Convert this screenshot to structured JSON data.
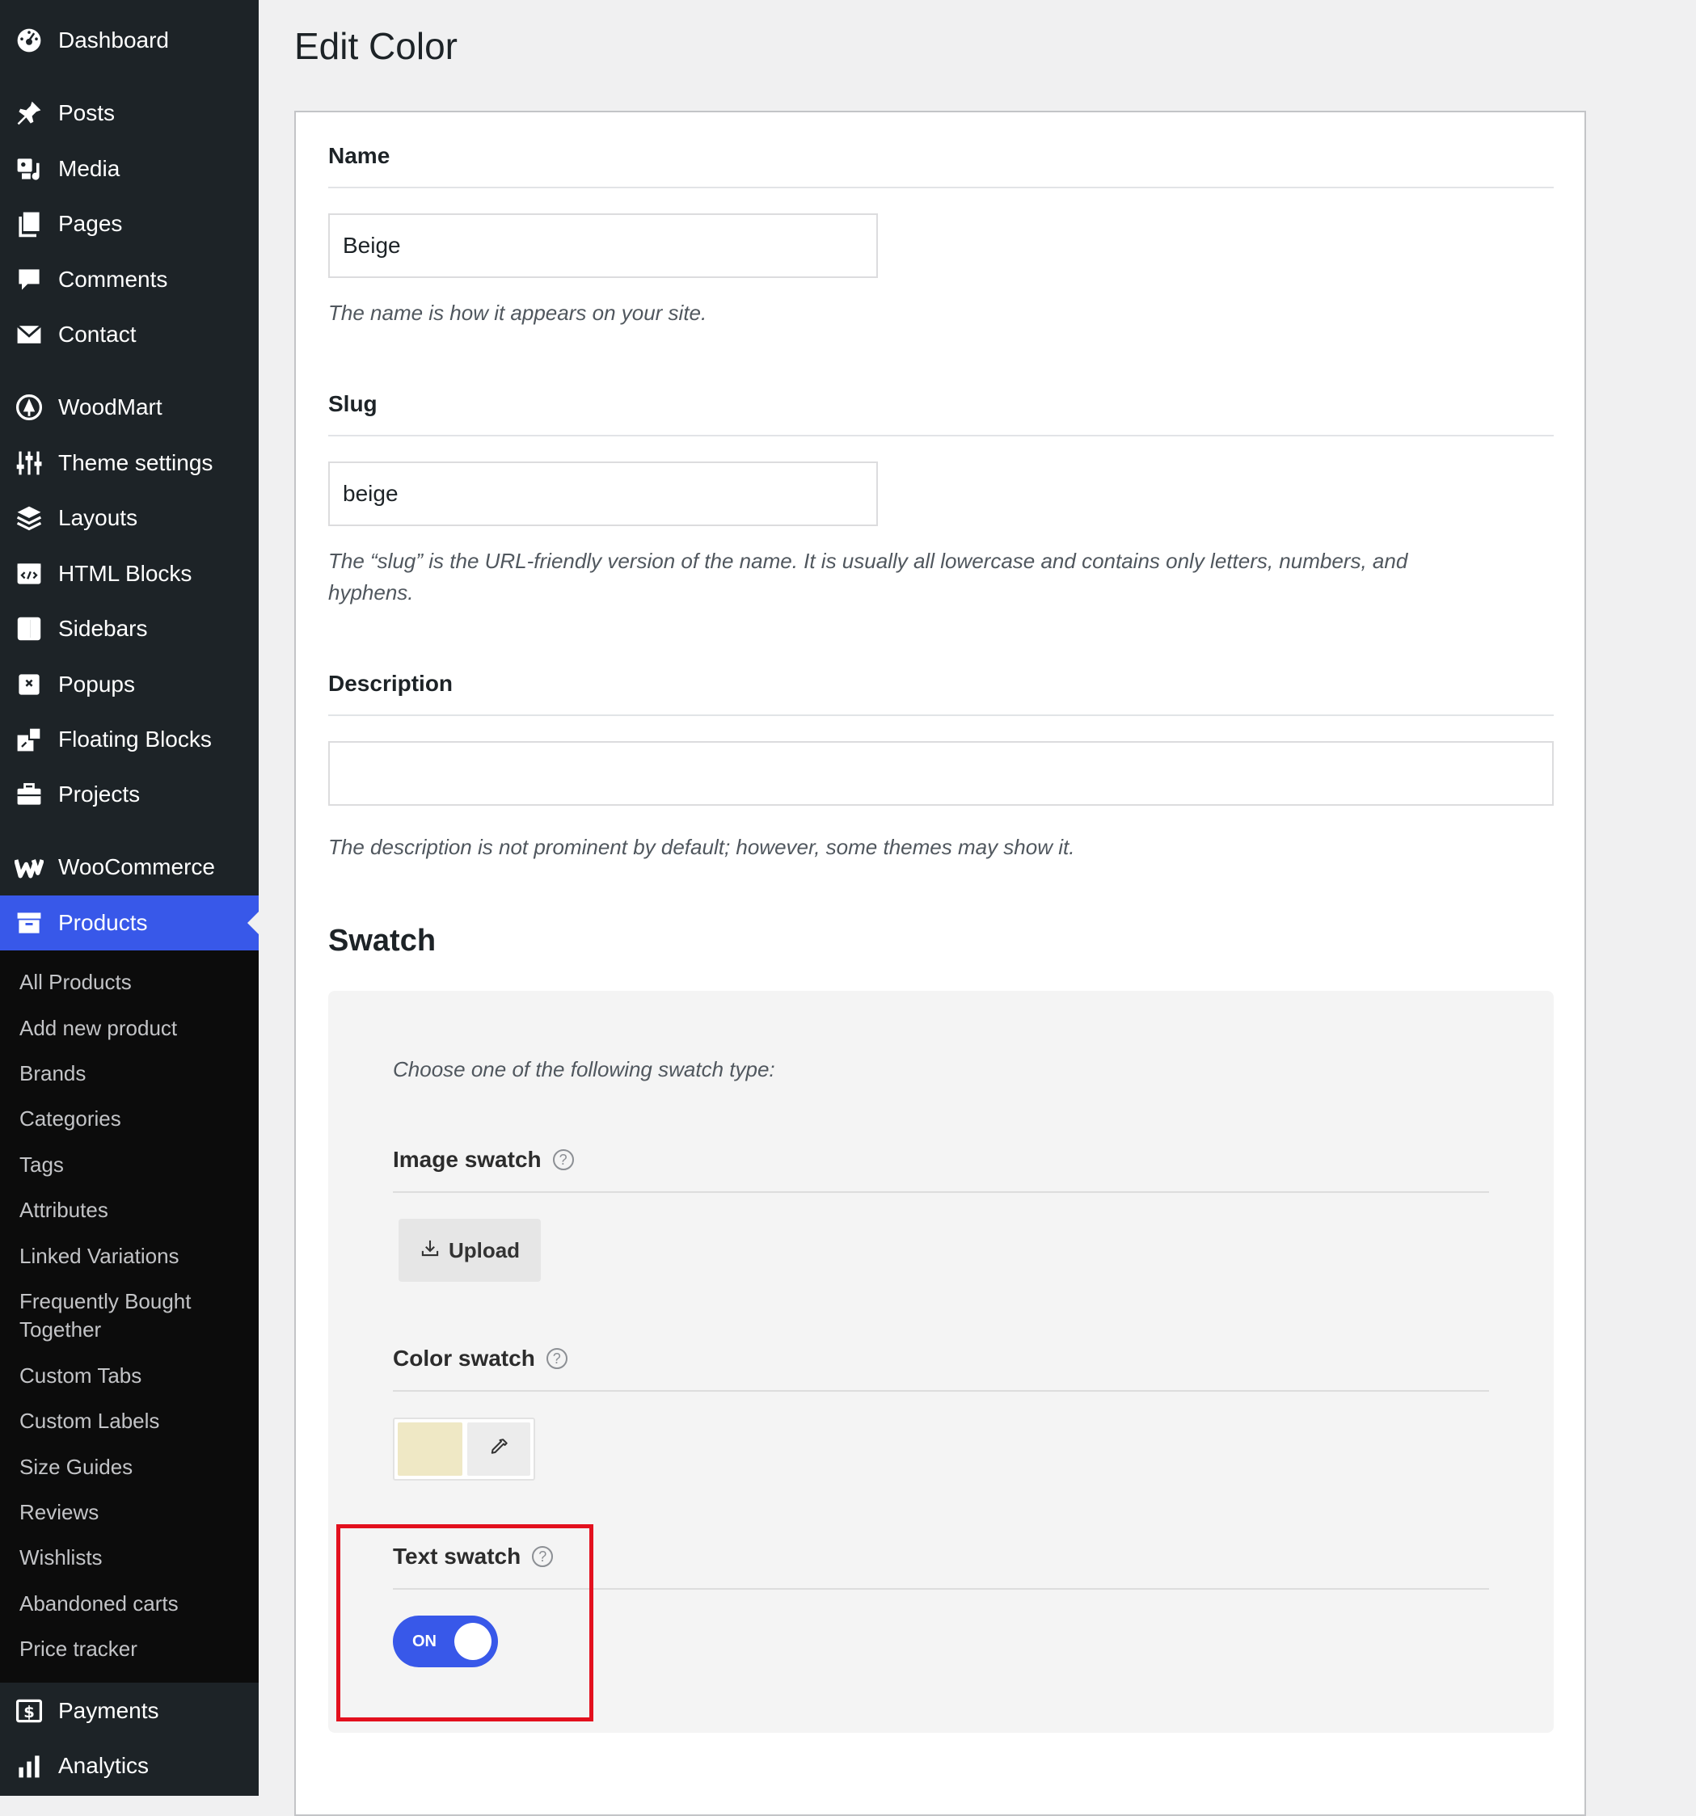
{
  "sidebar": {
    "items": [
      {
        "label": "Dashboard",
        "icon": "dashboard-icon"
      },
      {
        "label": "Posts",
        "icon": "pushpin-icon"
      },
      {
        "label": "Media",
        "icon": "media-icon"
      },
      {
        "label": "Pages",
        "icon": "pages-icon"
      },
      {
        "label": "Comments",
        "icon": "comment-icon"
      },
      {
        "label": "Contact",
        "icon": "envelope-icon"
      },
      {
        "label": "WoodMart",
        "icon": "woodmart-icon"
      },
      {
        "label": "Theme settings",
        "icon": "sliders-icon"
      },
      {
        "label": "Layouts",
        "icon": "layers-icon"
      },
      {
        "label": "HTML Blocks",
        "icon": "code-block-icon"
      },
      {
        "label": "Sidebars",
        "icon": "sidebar-icon"
      },
      {
        "label": "Popups",
        "icon": "popup-icon"
      },
      {
        "label": "Floating Blocks",
        "icon": "floating-block-icon"
      },
      {
        "label": "Projects",
        "icon": "briefcase-icon"
      },
      {
        "label": "WooCommerce",
        "icon": "woocommerce-icon"
      },
      {
        "label": "Products",
        "icon": "archive-icon"
      },
      {
        "label": "Payments",
        "icon": "dollar-icon"
      },
      {
        "label": "Analytics",
        "icon": "bar-chart-icon"
      }
    ],
    "active": "Products",
    "submenu": [
      "All Products",
      "Add new product",
      "Brands",
      "Categories",
      "Tags",
      "Attributes",
      "Linked Variations",
      "Frequently Bought Together",
      "Custom Tabs",
      "Custom Labels",
      "Size Guides",
      "Reviews",
      "Wishlists",
      "Abandoned carts",
      "Price tracker"
    ]
  },
  "page": {
    "title": "Edit Color"
  },
  "form": {
    "name": {
      "label": "Name",
      "value": "Beige",
      "help": "The name is how it appears on your site."
    },
    "slug": {
      "label": "Slug",
      "value": "beige",
      "help": "The “slug” is the URL-friendly version of the name. It is usually all lowercase and contains only letters, numbers, and hyphens."
    },
    "description": {
      "label": "Description",
      "value": "",
      "help": "The description is not prominent by default; however, some themes may show it."
    }
  },
  "swatch": {
    "heading": "Swatch",
    "intro": "Choose one of the following swatch type:",
    "image_swatch": {
      "label": "Image swatch",
      "help_glyph": "?",
      "upload_label": "Upload"
    },
    "color_swatch": {
      "label": "Color swatch",
      "help_glyph": "?",
      "color": "#efe8c5"
    },
    "text_swatch": {
      "label": "Text swatch",
      "help_glyph": "?",
      "toggle_state": "ON",
      "toggle_on": true
    }
  },
  "colors": {
    "sidebar_bg": "#1d2327",
    "submenu_bg": "#0c0c0c",
    "accent": "#3858e9",
    "highlight": "#e3101e"
  }
}
